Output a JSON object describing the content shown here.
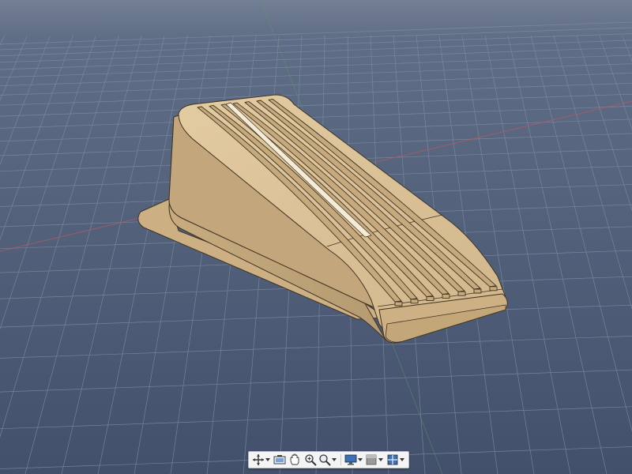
{
  "viewport": {
    "background_top": "#6e7b90",
    "background_bottom": "#3f4d68",
    "grid_color": "#8996ab",
    "axis_x_color": "#b6585d",
    "axis_y_color": "#5c9a6b"
  },
  "model": {
    "name": "door-stop-wedge",
    "body_color": "#d7bd93",
    "body_shadow": "#a88d66",
    "body_highlight": "#eed9b4",
    "edge_color": "#3c3121"
  },
  "toolbar": {
    "buttons": [
      {
        "name": "orbit-icon",
        "has_menu": true
      },
      {
        "name": "look-at-icon",
        "has_menu": false
      },
      {
        "name": "pan-icon",
        "has_menu": false
      },
      {
        "name": "zoom-icon",
        "has_menu": false
      },
      {
        "name": "fit-window-icon",
        "has_menu": true
      },
      {
        "name": "display-settings-icon",
        "has_menu": true
      },
      {
        "name": "grid-snap-icon",
        "has_menu": true
      },
      {
        "name": "viewports-icon",
        "has_menu": true
      }
    ],
    "accent": "#3b6fb6"
  }
}
